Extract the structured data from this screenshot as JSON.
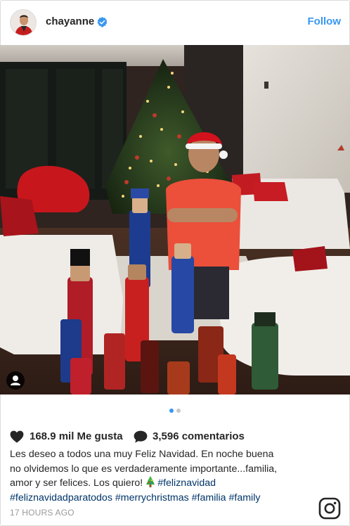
{
  "post": {
    "username": "chayanne",
    "follow_label": "Follow",
    "likes_text": "168.9 mil Me gusta",
    "comments_text": "3,596 comentarios",
    "caption_line1": "Les deseo a todos una muy Feliz Navidad. En noche buena",
    "caption_line2": "no olvidemos lo que es verdaderamente importante...familia,",
    "caption_line3_text": "amor y ser felices. Los quiero! ",
    "hashtags": [
      "#feliznavidad",
      "#feliznavidadparatodos",
      "#merrychristmas",
      "#familia",
      "#family"
    ],
    "timestamp": "17 HOURS AGO",
    "carousel": {
      "count": 2,
      "active": 1
    }
  },
  "icons": {
    "avatar": "avatar",
    "verified": "verified-badge-icon",
    "like": "heart-icon",
    "comment": "comment-bubble-icon",
    "tag": "person-tag-icon",
    "emoji": "christmas-tree-emoji",
    "brand": "instagram-logo-icon"
  },
  "colors": {
    "accent": "#3897f0",
    "hashtag": "#003569",
    "muted": "#999999",
    "text": "#262626"
  }
}
